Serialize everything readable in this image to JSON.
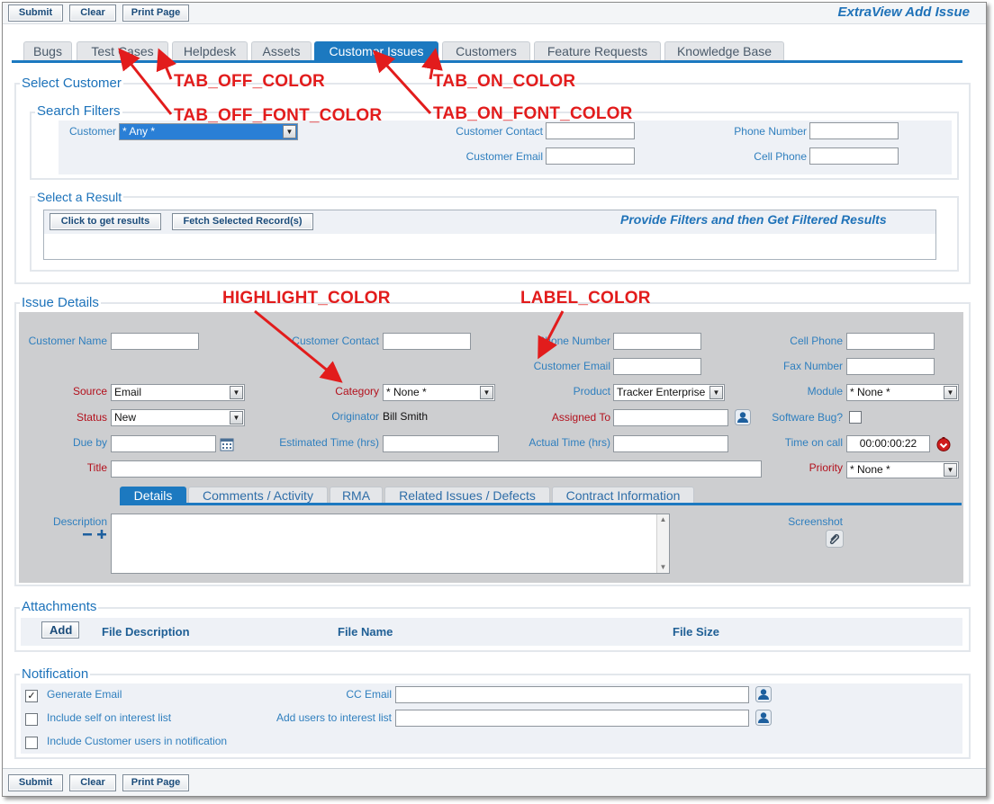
{
  "toolbar": {
    "submit": "Submit",
    "clear": "Clear",
    "print": "Print Page"
  },
  "app_title": "ExtraView Add Issue",
  "tabs": [
    "Bugs",
    "Test Cases",
    "Helpdesk",
    "Assets",
    "Customer Issues",
    "Customers",
    "Feature Requests",
    "Knowledge Base"
  ],
  "active_tab": "Customer Issues",
  "select_customer": {
    "legend": "Select Customer",
    "search_legend": "Search Filters",
    "customer_label": "Customer",
    "customer_value": "* Any *",
    "contact_label": "Customer Contact",
    "email_label": "Customer Email",
    "phone_label": "Phone Number",
    "cell_label": "Cell Phone",
    "result_legend": "Select a Result",
    "get_results": "Click to get results",
    "fetch_selected": "Fetch Selected Record(s)",
    "result_hint": "Provide Filters and then Get Filtered Results"
  },
  "issue": {
    "legend": "Issue Details",
    "customer_name": "Customer Name",
    "customer_contact": "Customer Contact",
    "phone_number": "Phone Number",
    "cell_phone": "Cell Phone",
    "customer_email": "Customer Email",
    "fax_number": "Fax Number",
    "source_label": "Source",
    "source_value": "Email",
    "category_label": "Category",
    "category_value": "* None *",
    "product_label": "Product",
    "product_value": "Tracker Enterprise",
    "module_label": "Module",
    "module_value": "* None *",
    "status_label": "Status",
    "status_value": "New",
    "originator_label": "Originator",
    "originator_value": "Bill Smith",
    "assigned_label": "Assigned To",
    "software_bug_label": "Software Bug?",
    "due_label": "Due by",
    "estimated_label": "Estimated Time (hrs)",
    "actual_label": "Actual Time (hrs)",
    "time_on_call_label": "Time on call",
    "time_on_call_value": "00:00:00:22",
    "title_label": "Title",
    "priority_label": "Priority",
    "priority_value": "* None *",
    "subtabs": [
      "Details",
      "Comments / Activity",
      "RMA",
      "Related Issues / Defects",
      "Contract Information"
    ],
    "description_label": "Description",
    "screenshot_label": "Screenshot"
  },
  "attachments": {
    "legend": "Attachments",
    "add": "Add",
    "col_desc": "File Description",
    "col_name": "File Name",
    "col_size": "File Size"
  },
  "notification": {
    "legend": "Notification",
    "generate_email": "Generate Email",
    "generate_checked": "✓",
    "include_self": "Include self on interest list",
    "include_customer": "Include Customer users in notification",
    "cc_email": "CC Email",
    "add_users": "Add users to interest list"
  },
  "annotations": {
    "tab_off_color": "TAB_OFF_COLOR",
    "tab_on_color": "TAB_ON_COLOR",
    "tab_off_font_color": "TAB_OFF_FONT_COLOR",
    "tab_on_font_color": "TAB_ON_FONT_COLOR",
    "highlight_color": "HIGHLIGHT_COLOR",
    "label_color": "LABEL_COLOR"
  },
  "colors": {
    "tab_on": "#1c79c0",
    "tab_off": "#e4e6e9",
    "label": "#2f7fbe",
    "highlight": "#b3101c",
    "annotation": "#e21c1c"
  }
}
